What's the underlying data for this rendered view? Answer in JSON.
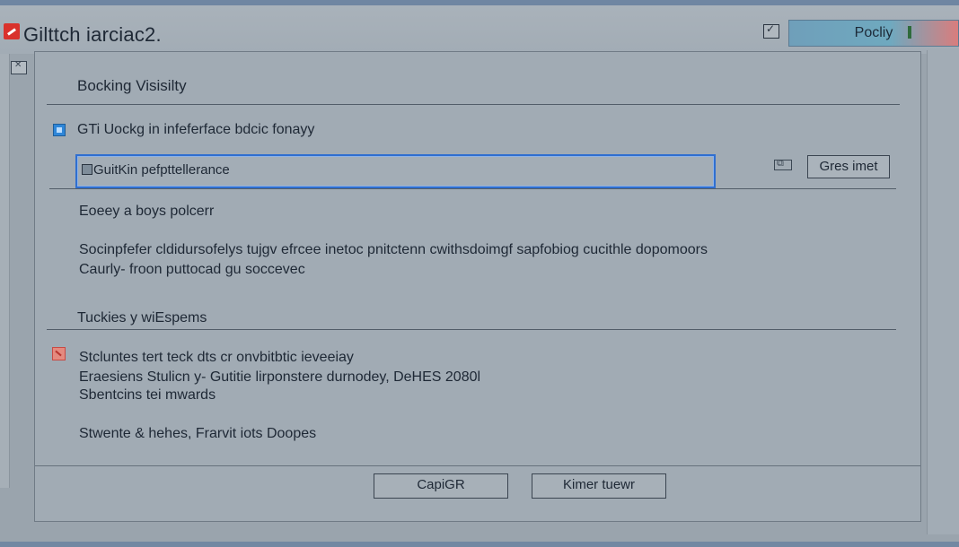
{
  "window": {
    "title": "Gilttch iarciac2."
  },
  "toolbar": {
    "policy_button_label": "Pocliy"
  },
  "dialog": {
    "section_title": "Bocking Visisilty",
    "checkbox_label": "GTi Uockg in infeferface bdcic fonayy",
    "field_value": "GuitKin pefpttellerance",
    "side_button_label": "Gres imet",
    "paragraph_1": "Eoeey a boys polcerr",
    "paragraph_2_line_1": "Socinpfefer cldidursofelys tujgv efrcee inetoc pnitctenn cwithsdoimgf sapfobiog cucithle dopomoors",
    "paragraph_2_line_2": "Caurly- froon puttocad gu soccevec",
    "section_title_2": "Tuckies y  wiEspems",
    "block_line_1": "Stcluntes tert teck dts cr onvbitbtic ieveeiay",
    "block_line_2": "Eraesiens Stulicn y- Gutitie lirponstere durnodey, DeHES  2080l",
    "block_line_3": "Sbentcins tei mwards",
    "summary_line": "Stwente & hehes, Frarvit iots Doopes",
    "footer_left_button": "CapiGR",
    "footer_right_button": "Kimer tuewr"
  },
  "colors": {
    "accent_blue": "#2f6fd1",
    "brand_red": "#d9322c",
    "panel_bg": "#a1abb4"
  },
  "icons": {
    "app": "app-logo-icon",
    "window_mini": "checkbox-window-icon",
    "side": "side-collapse-icon",
    "field": "field-doc-icon",
    "small": "copy-icon",
    "warning": "warning-icon"
  }
}
